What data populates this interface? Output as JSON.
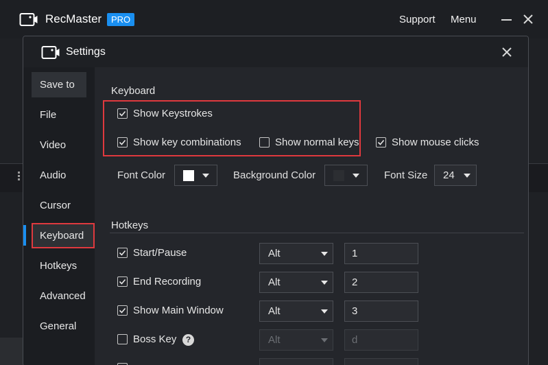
{
  "app": {
    "title": "RecMaster",
    "badge": "PRO",
    "support_label": "Support",
    "menu_label": "Menu"
  },
  "dialog": {
    "title": "Settings"
  },
  "sidebar": {
    "items": [
      {
        "label": "Save to"
      },
      {
        "label": "File"
      },
      {
        "label": "Video"
      },
      {
        "label": "Audio"
      },
      {
        "label": "Cursor"
      },
      {
        "label": "Keyboard"
      },
      {
        "label": "Hotkeys"
      },
      {
        "label": "Advanced"
      },
      {
        "label": "General"
      }
    ],
    "selected": "Keyboard"
  },
  "keyboard": {
    "section_title": "Keyboard",
    "show_keystrokes": {
      "label": "Show Keystrokes",
      "checked": true
    },
    "show_key_combinations": {
      "label": "Show key combinations",
      "checked": true
    },
    "show_normal_keys": {
      "label": "Show normal keys",
      "checked": false
    },
    "show_mouse_clicks": {
      "label": "Show mouse clicks",
      "checked": true
    },
    "font_color": {
      "label": "Font Color",
      "value": "#ffffff"
    },
    "background_color": {
      "label": "Background Color",
      "value": "#2c2e32"
    },
    "font_size": {
      "label": "Font Size",
      "value": "24"
    }
  },
  "hotkeys": {
    "section_title": "Hotkeys",
    "rows": [
      {
        "label": "Start/Pause",
        "checked": true,
        "modifier": "Alt",
        "key": "1",
        "enabled": true
      },
      {
        "label": "End Recording",
        "checked": true,
        "modifier": "Alt",
        "key": "2",
        "enabled": true
      },
      {
        "label": "Show Main Window",
        "checked": true,
        "modifier": "Alt",
        "key": "3",
        "enabled": true
      },
      {
        "label": "Boss Key",
        "checked": false,
        "modifier": "Alt",
        "key": "d",
        "enabled": false
      }
    ],
    "help_glyph": "?"
  },
  "colors": {
    "accent": "#1a8ff0",
    "highlight": "#e0393e"
  }
}
